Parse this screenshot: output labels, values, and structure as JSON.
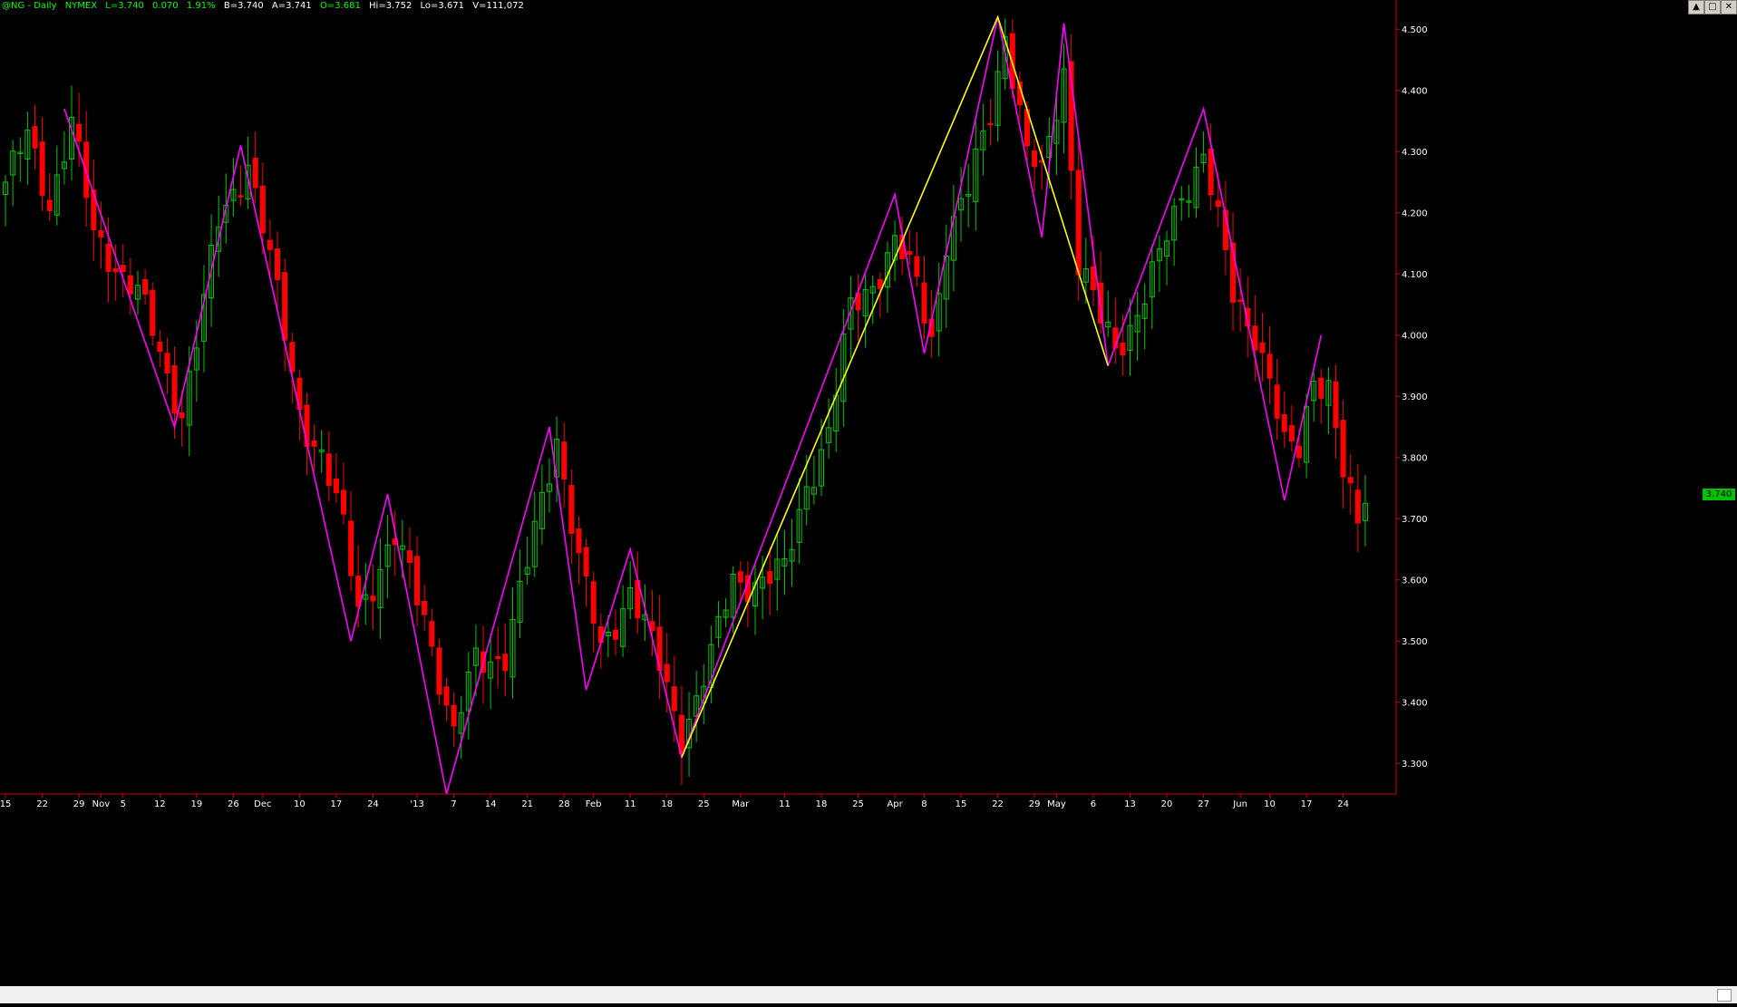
{
  "header": {
    "symbol": "@NG - Daily",
    "exchange": "NYMEX",
    "last": "L=3.740",
    "change": "0.070",
    "change_pct": "1.91%",
    "bid": "B=3.740",
    "ask": "A=3.741",
    "open": "O=3.681",
    "high": "Hi=3.752",
    "low": "Lo=3.671",
    "volume": "V=111,072"
  },
  "window_controls": {
    "minimize": "▲",
    "maximize": "□",
    "close": "✕"
  },
  "colors": {
    "background": "#000000",
    "up_candle": "#00c800",
    "down_candle": "#ff0000",
    "zigzag_minor": "#ff00ff",
    "zigzag_major": "#ffff00",
    "axis": "#cc0000",
    "text": "#ffffff"
  },
  "chart_data": {
    "type": "candlestick",
    "last_price_tag": "3.740",
    "ylim": [
      3.25,
      4.53
    ],
    "y_ticks": [
      "4.500",
      "4.400",
      "4.300",
      "4.200",
      "4.100",
      "4.000",
      "3.900",
      "3.800",
      "3.700",
      "3.600",
      "3.500",
      "3.400",
      "3.300"
    ],
    "x_labels": [
      "15",
      "22",
      "29",
      "Nov",
      "5",
      "12",
      "19",
      "26",
      "Dec",
      "10",
      "17",
      "24",
      "'13",
      "7",
      "14",
      "21",
      "28",
      "Feb",
      "11",
      "18",
      "25",
      "Mar",
      "11",
      "18",
      "25",
      "Apr",
      "8",
      "15",
      "22",
      "29",
      "May",
      "6",
      "13",
      "20",
      "27",
      "Jun",
      "10",
      "17",
      "24"
    ],
    "bar_count": 186,
    "label_bars": [
      0,
      5,
      10,
      13,
      16,
      21,
      26,
      31,
      35,
      40,
      45,
      50,
      56,
      61,
      66,
      71,
      76,
      80,
      85,
      90,
      95,
      100,
      106,
      111,
      116,
      121,
      125,
      130,
      135,
      140,
      143,
      148,
      153,
      158,
      163,
      168,
      172,
      177,
      182
    ],
    "closes": [
      {
        "i": 0,
        "v": 4.25
      },
      {
        "i": 3,
        "v": 4.32
      },
      {
        "i": 6,
        "v": 4.22
      },
      {
        "i": 9,
        "v": 4.35
      },
      {
        "i": 12,
        "v": 4.16
      },
      {
        "i": 15,
        "v": 4.12
      },
      {
        "i": 18,
        "v": 4.07
      },
      {
        "i": 22,
        "v": 3.93
      },
      {
        "i": 24,
        "v": 3.88
      },
      {
        "i": 27,
        "v": 4.05
      },
      {
        "i": 29,
        "v": 4.18
      },
      {
        "i": 33,
        "v": 4.29
      },
      {
        "i": 36,
        "v": 4.12
      },
      {
        "i": 40,
        "v": 3.88
      },
      {
        "i": 43,
        "v": 3.8
      },
      {
        "i": 46,
        "v": 3.68
      },
      {
        "i": 48,
        "v": 3.56
      },
      {
        "i": 53,
        "v": 3.66
      },
      {
        "i": 57,
        "v": 3.55
      },
      {
        "i": 61,
        "v": 3.34
      },
      {
        "i": 64,
        "v": 3.47
      },
      {
        "i": 68,
        "v": 3.48
      },
      {
        "i": 71,
        "v": 3.62
      },
      {
        "i": 75,
        "v": 3.84
      },
      {
        "i": 78,
        "v": 3.63
      },
      {
        "i": 81,
        "v": 3.48
      },
      {
        "i": 85,
        "v": 3.59
      },
      {
        "i": 88,
        "v": 3.49
      },
      {
        "i": 92,
        "v": 3.35
      },
      {
        "i": 96,
        "v": 3.47
      },
      {
        "i": 99,
        "v": 3.6
      },
      {
        "i": 103,
        "v": 3.6
      },
      {
        "i": 106,
        "v": 3.61
      },
      {
        "i": 109,
        "v": 3.76
      },
      {
        "i": 112,
        "v": 3.84
      },
      {
        "i": 115,
        "v": 4.04
      },
      {
        "i": 118,
        "v": 4.09
      },
      {
        "i": 121,
        "v": 4.15
      },
      {
        "i": 124,
        "v": 4.08
      },
      {
        "i": 126,
        "v": 4.0
      },
      {
        "i": 128,
        "v": 4.16
      },
      {
        "i": 131,
        "v": 4.23
      },
      {
        "i": 134,
        "v": 4.37
      },
      {
        "i": 136,
        "v": 4.5
      },
      {
        "i": 139,
        "v": 4.29
      },
      {
        "i": 141,
        "v": 4.26
      },
      {
        "i": 144,
        "v": 4.44
      },
      {
        "i": 146,
        "v": 4.12
      },
      {
        "i": 149,
        "v": 4.02
      },
      {
        "i": 151,
        "v": 3.98
      },
      {
        "i": 154,
        "v": 4.04
      },
      {
        "i": 157,
        "v": 4.12
      },
      {
        "i": 160,
        "v": 4.23
      },
      {
        "i": 163,
        "v": 4.3
      },
      {
        "i": 165,
        "v": 4.18
      },
      {
        "i": 167,
        "v": 4.06
      },
      {
        "i": 170,
        "v": 4.01
      },
      {
        "i": 172,
        "v": 3.93
      },
      {
        "i": 174,
        "v": 3.81
      },
      {
        "i": 176,
        "v": 3.81
      },
      {
        "i": 178,
        "v": 3.94
      },
      {
        "i": 180,
        "v": 3.92
      },
      {
        "i": 182,
        "v": 3.77
      },
      {
        "i": 184,
        "v": 3.68
      },
      {
        "i": 185,
        "v": 3.74
      }
    ],
    "zigzag_minor": [
      {
        "i": 8,
        "v": 4.37
      },
      {
        "i": 23,
        "v": 3.85
      },
      {
        "i": 32,
        "v": 4.31
      },
      {
        "i": 47,
        "v": 3.5
      },
      {
        "i": 52,
        "v": 3.74
      },
      {
        "i": 60,
        "v": 3.25
      },
      {
        "i": 74,
        "v": 3.85
      },
      {
        "i": 79,
        "v": 3.42
      },
      {
        "i": 85,
        "v": 3.65
      },
      {
        "i": 92,
        "v": 3.31
      },
      {
        "i": 121,
        "v": 4.23
      },
      {
        "i": 125,
        "v": 3.97
      },
      {
        "i": 135,
        "v": 4.52
      },
      {
        "i": 141,
        "v": 4.16
      },
      {
        "i": 144,
        "v": 4.51
      },
      {
        "i": 150,
        "v": 3.95
      },
      {
        "i": 163,
        "v": 4.37
      },
      {
        "i": 174,
        "v": 3.73
      },
      {
        "i": 179,
        "v": 4.0
      }
    ],
    "zigzag_major": [
      {
        "i": 92,
        "v": 3.31
      },
      {
        "i": 135,
        "v": 4.52
      },
      {
        "i": 150,
        "v": 3.95
      }
    ]
  }
}
